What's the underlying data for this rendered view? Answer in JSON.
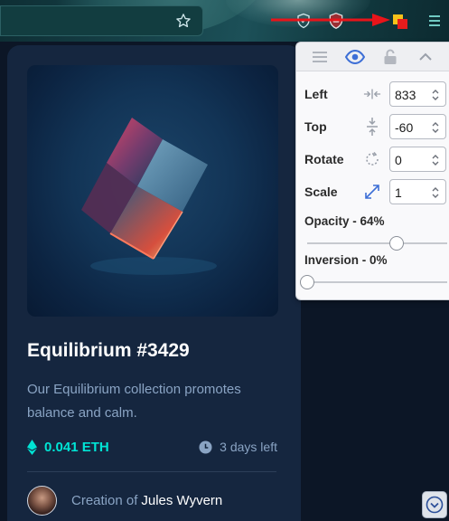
{
  "browser": {
    "icons": [
      "star-icon",
      "shield-icon",
      "shield-badge-icon",
      "overlay-extension-icon",
      "hamburger-menu-icon"
    ]
  },
  "nft": {
    "title": "Equilibrium #3429",
    "description": "Our Equilibrium collection promotes balance and calm.",
    "price": "0.041 ETH",
    "time_left": "3 days left",
    "creator_prefix": "Creation of",
    "creator_name": "Jules Wyvern"
  },
  "panel": {
    "header_icons": [
      "drag-handle-icon",
      "eye-icon",
      "unlock-icon",
      "collapse-icon"
    ],
    "fields": [
      {
        "label": "Left",
        "value": "833",
        "icon": "horizontal-position-icon"
      },
      {
        "label": "Top",
        "value": "-60",
        "icon": "vertical-position-icon"
      },
      {
        "label": "Rotate",
        "value": "0",
        "icon": "rotate-icon"
      },
      {
        "label": "Scale",
        "value": "1",
        "icon": "scale-icon"
      }
    ],
    "opacity": {
      "label": "Opacity - 64%",
      "value": 0.64
    },
    "inversion": {
      "label": "Inversion - 0%",
      "value": 0.0
    }
  },
  "colors": {
    "accent": "#00e4d5",
    "card_bg": "#15263f",
    "page_bg": "#0c1626",
    "panel_icon_blue": "#3d6fd6",
    "annotation_red": "#e8141a"
  }
}
